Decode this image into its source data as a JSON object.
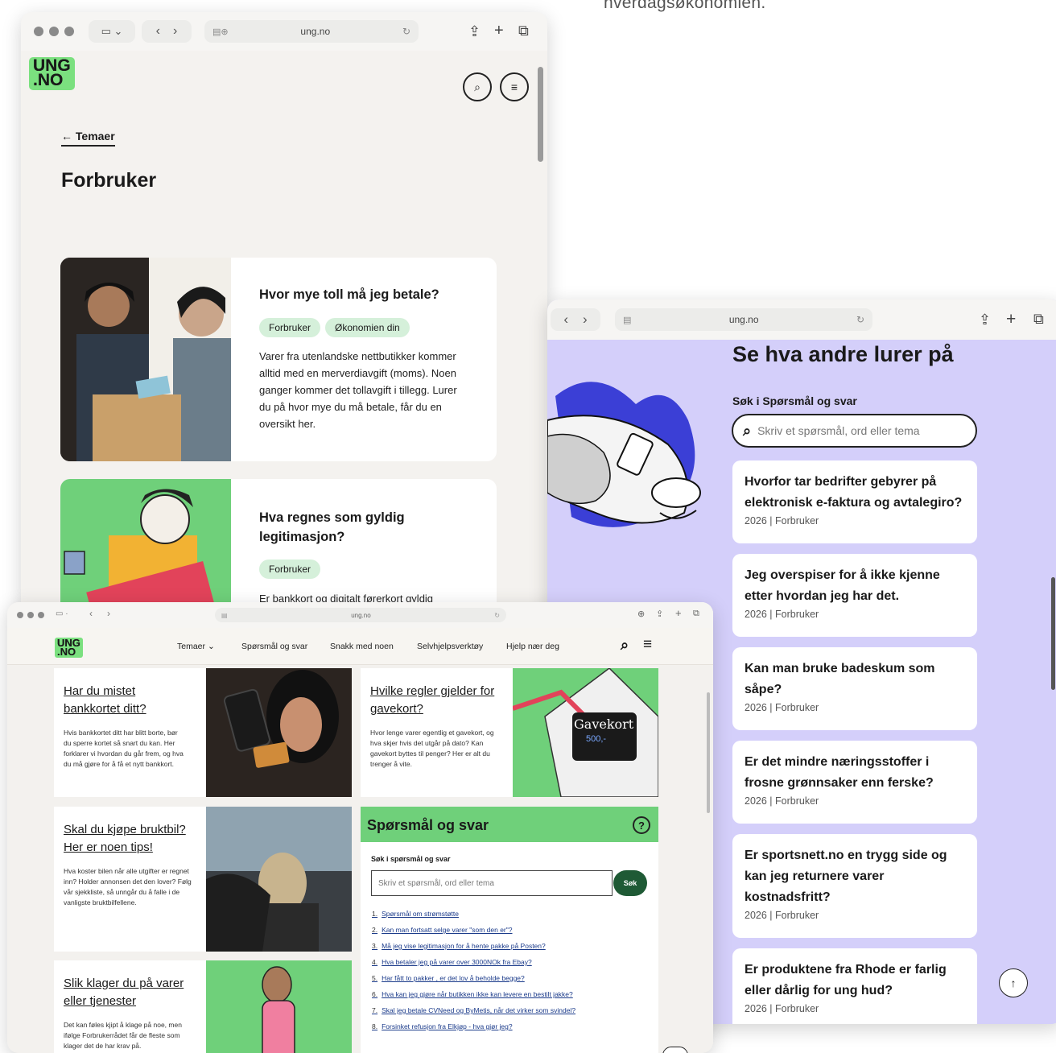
{
  "caption": "hverdagsøkonomien.",
  "win_a": {
    "url": "ung.no",
    "logo": [
      "UNG",
      ".NO"
    ],
    "back_label": "Temaer",
    "page_title": "Forbruker",
    "cards": [
      {
        "title": "Hvor mye toll må jeg betale?",
        "tags": [
          "Forbruker",
          "Økonomien din"
        ],
        "text": "Varer fra utenlandske nettbutikker kommer alltid med en merverdiavgift (moms). Noen ganger kommer det tollavgift i tillegg. Lurer du på hvor mye du må betale, får du en oversikt her."
      },
      {
        "title": "Hva regnes som gyldig legitimasjon?",
        "tags": [
          "Forbruker"
        ],
        "text": "Er bankkort og digitalt førerkort gyldig legitimasjon, eller er det pass og"
      }
    ]
  },
  "win_b": {
    "url": "ung.no",
    "heading": "Se hva andre lurer på",
    "search_label": "Søk i Spørsmål og svar",
    "search_placeholder": "Skriv et spørsmål, ord eller tema",
    "questions": [
      {
        "q": "Hvorfor tar bedrifter gebyrer på elektronisk e-faktura og avtalegiro?",
        "meta": "2026 | Forbruker"
      },
      {
        "q": "Jeg overspiser for å ikke kjenne etter hvordan jeg har det.",
        "meta": "2026 | Forbruker"
      },
      {
        "q": "Kan man bruke badeskum som såpe?",
        "meta": "2026 | Forbruker"
      },
      {
        "q": "Er det mindre næringsstoffer i frosne grønnsaker enn ferske?",
        "meta": "2026 | Forbruker"
      },
      {
        "q": "Er sportsnett.no en trygg side og kan jeg returnere varer kostnadsfritt?",
        "meta": "2026 | Forbruker"
      },
      {
        "q": "Er produktene fra Rhode er farlig eller dårlig for ung hud?",
        "meta": "2026 | Forbruker"
      }
    ]
  },
  "win_c": {
    "url": "ung.no",
    "logo": [
      "UNG",
      ".NO"
    ],
    "nav": [
      "Temaer",
      "Spørsmål og svar",
      "Snakk med noen",
      "Selvhjelpsverktøy",
      "Hjelp nær deg"
    ],
    "articles": [
      {
        "title": "Har du mistet bankkortet ditt?",
        "text": "Hvis bankkortet ditt har blitt borte, bør du sperre kortet så snart du kan. Her forklarer vi hvordan du går frem, og hva du må gjøre for å få et nytt bankkort."
      },
      {
        "title": "Hvilke regler gjelder for gavekort?",
        "text": "Hvor lenge varer egentlig et gavekort, og hva skjer hvis det utgår på dato? Kan gavekort byttes til penger? Her er alt du trenger å vite."
      },
      {
        "title": "Skal du kjøpe bruktbil? Her er noen tips!",
        "text": "Hva koster bilen når alle utgifter er regnet inn? Holder annonsen det den lover? Følg vår sjekkliste, så unngår du å falle i de vanligste bruktbilfellene."
      },
      {
        "title": "Slik klager du på varer eller tjenester",
        "text": "Det kan føles kjipt å klage på noe, men ifølge Forbrukerrådet får de fleste som klager det de har krav på."
      }
    ],
    "gavekort": {
      "line1": "Gavekort",
      "line2": "500,-"
    },
    "qa": {
      "heading": "Spørsmål og svar",
      "search_label": "Søk i spørsmål og svar",
      "placeholder": "Skriv et spørsmål, ord eller tema",
      "button": "Søk",
      "items": [
        "Spørsmål om strømstøtte",
        "Kan man fortsatt selge varer \"som den er\"?",
        "Må jeg vise legitimasjon for å hente pakke på Posten?",
        "Hva betaler jeg på varer over 3000NOk fra Ebay?",
        "Har fått to pakker , er det lov å beholde begge?",
        "Hva kan jeg gjøre når butikken ikke kan levere en bestilt jakke?",
        "Skal jeg betale CVNeed og ByMetis, når det virker som svindel?",
        "Forsinket refusjon fra Elkjøp - hva gjør jeg?"
      ]
    }
  }
}
